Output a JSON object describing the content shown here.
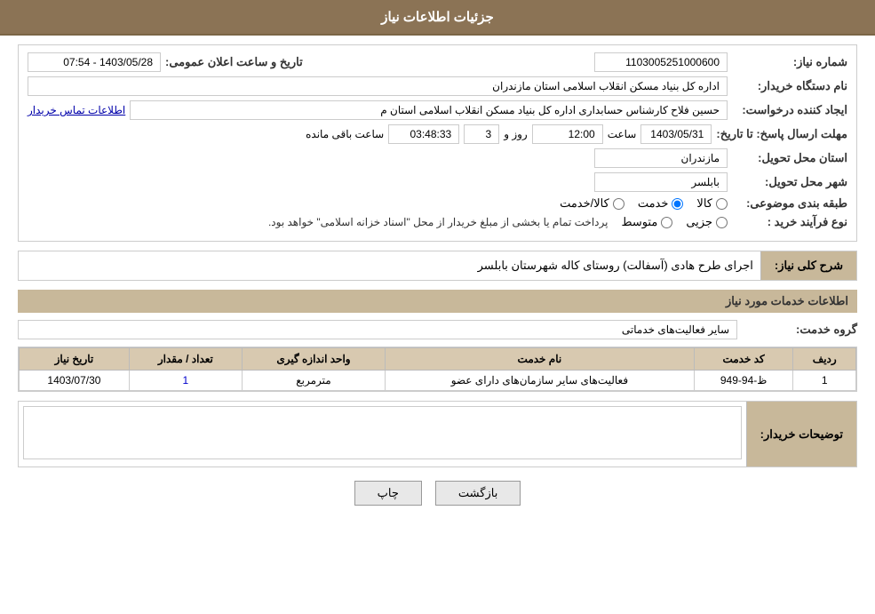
{
  "header": {
    "title": "جزئیات اطلاعات نیاز"
  },
  "fields": {
    "shomareNiaz_label": "شماره نیاز:",
    "shomareNiaz_value": "1103005251000600",
    "namdastgah_label": "نام دستگاه خریدار:",
    "namdastgah_value": "اداره کل بنیاد مسکن انقلاب اسلامی استان مازندران",
    "tarikh_label": "تاریخ و ساعت اعلان عمومی:",
    "tarikh_value": "1403/05/28 - 07:54",
    "ijadkonande_label": "ایجاد کننده درخواست:",
    "ijadkonande_value": "حسین فلاح کارشناس حسابداری اداره کل بنیاد مسکن انقلاب اسلامی استان م",
    "ettelaat_link": "اطلاعات تماس خریدار",
    "mohlat_label": "مهلت ارسال پاسخ: تا تاریخ:",
    "mohlat_date": "1403/05/31",
    "mohlat_time_label": "ساعت",
    "mohlat_time": "12:00",
    "mohlat_roz_label": "روز و",
    "mohlat_roz": "3",
    "mohlat_baghimande": "03:48:33",
    "mohlat_baghimande_label": "ساعت باقی مانده",
    "ostan_label": "استان محل تحویل:",
    "ostan_value": "مازندران",
    "shahr_label": "شهر محل تحویل:",
    "shahr_value": "بابلسر",
    "tabaghebandi_label": "طبقه بندی موضوعی:",
    "radio_kala": "کالا",
    "radio_khedmat": "خدمت",
    "radio_kala_khedmat": "کالا/خدمت",
    "radio_selected": "khedmat",
    "noeFarayand_label": "نوع فرآیند خرید :",
    "radio_jozei": "جزیی",
    "radio_motavaset": "متوسط",
    "noeFarayand_note": "پرداخت تمام یا بخشی از مبلغ خریدار از محل \"اسناد خزانه اسلامی\" خواهد بود.",
    "sharh_label": "شرح کلی نیاز:",
    "sharh_value": "اجرای طرح هادی (آسفالت) روستای کاله شهرستان بابلسر",
    "khedmat_section_title": "اطلاعات خدمات مورد نیاز",
    "grooh_label": "گروه خدمت:",
    "grooh_value": "سایر فعالیت‌های خدماتی",
    "table": {
      "headers": [
        "ردیف",
        "کد خدمت",
        "نام خدمت",
        "واحد اندازه گیری",
        "تعداد / مقدار",
        "تاریخ نیاز"
      ],
      "rows": [
        {
          "radif": "1",
          "kod": "ظ-94-949",
          "nam": "فعالیت‌های سایر سازمان‌های دارای عضو",
          "vahed": "مترمربع",
          "tedadMeqdad": "1",
          "tarikh": "1403/07/30"
        }
      ]
    },
    "tozihat_label": "توضیحات خریدار:",
    "tozihat_value": "",
    "btn_chap": "چاپ",
    "btn_bazgasht": "بازگشت"
  }
}
